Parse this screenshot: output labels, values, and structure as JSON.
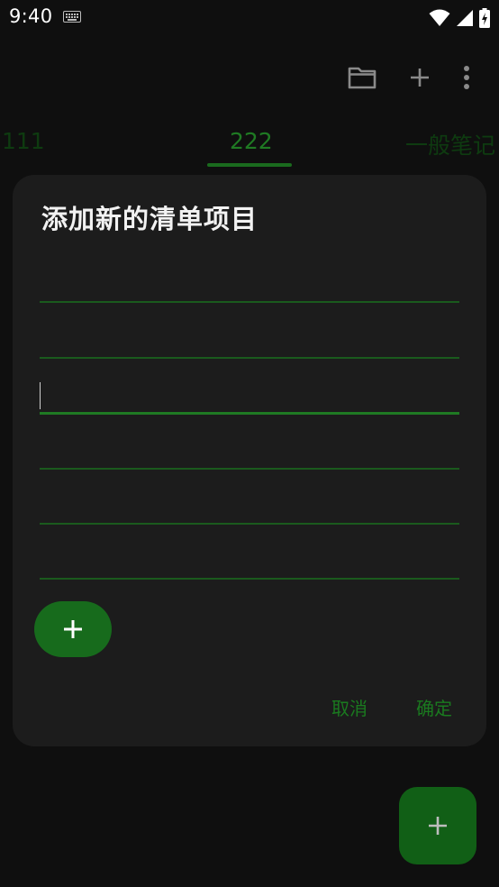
{
  "status_bar": {
    "time": "9:40",
    "icons": [
      "keyboard-icon",
      "wifi-icon",
      "signal-icon",
      "battery-charging-icon"
    ]
  },
  "app_bar": {
    "actions": [
      "folder-icon",
      "add-icon",
      "more-vert-icon"
    ]
  },
  "tabs": [
    {
      "label": "111",
      "selected": false
    },
    {
      "label": "222",
      "selected": true
    },
    {
      "label": "一般笔记",
      "selected": false
    }
  ],
  "dialog": {
    "title": "添加新的清单项目",
    "fields": [
      {
        "value": "",
        "focused": false
      },
      {
        "value": "",
        "focused": false
      },
      {
        "value": "",
        "focused": true
      },
      {
        "value": "",
        "focused": false
      },
      {
        "value": "",
        "focused": false
      },
      {
        "value": "",
        "focused": false
      }
    ],
    "add_item_icon": "add-icon",
    "cancel_label": "取消",
    "confirm_label": "确定"
  },
  "fab": {
    "icon": "add-icon"
  },
  "colors": {
    "accent": "#1a7a1f",
    "background": "#0f0f0f",
    "dialog_background": "#1c1c1c"
  }
}
